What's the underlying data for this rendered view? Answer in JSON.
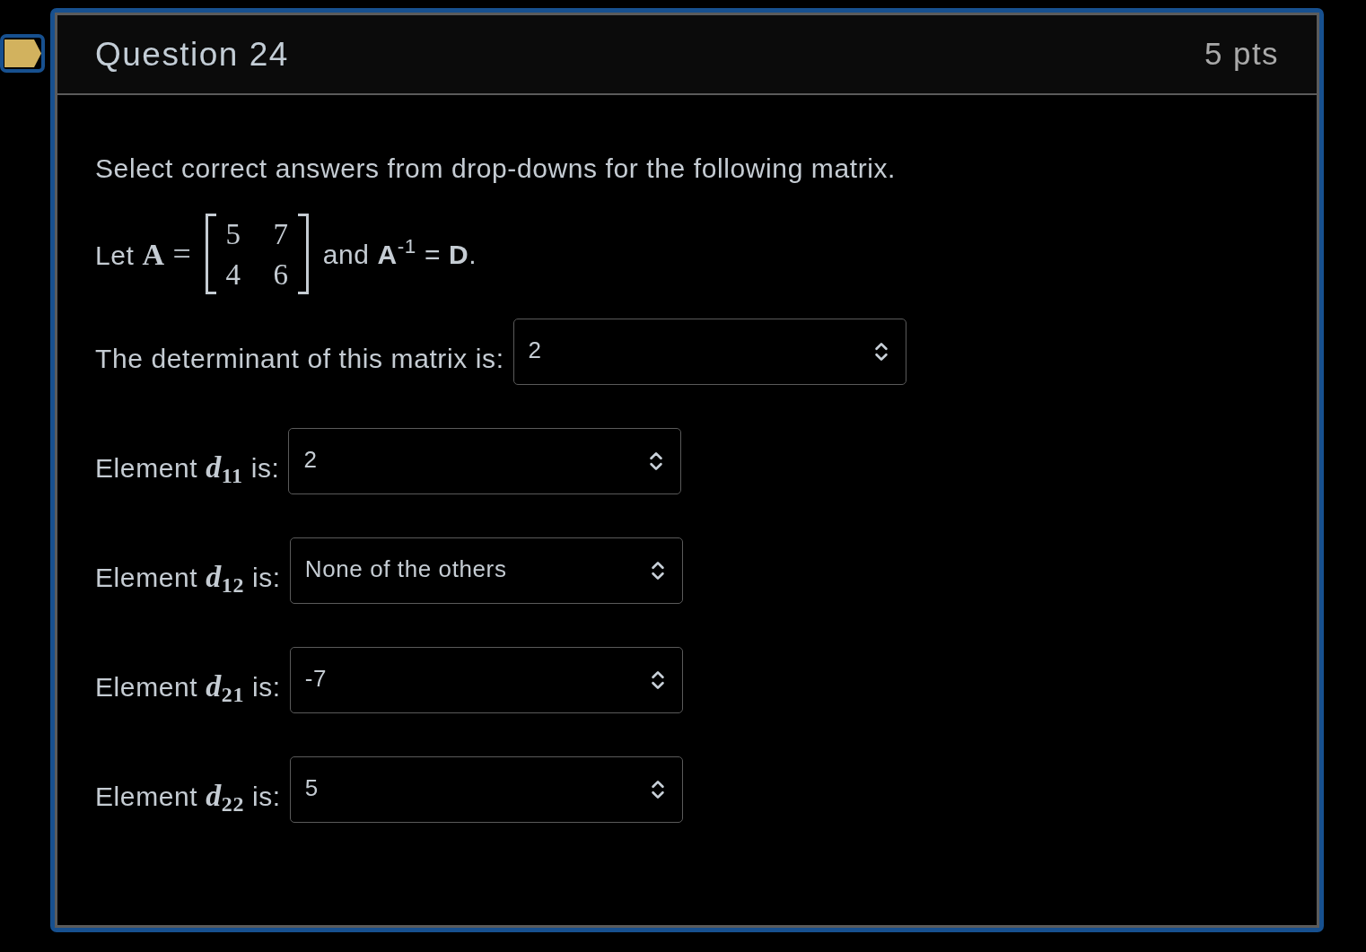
{
  "question": {
    "flagged": true,
    "title": "Question 24",
    "points": "5 pts"
  },
  "instructions": "Select correct answers from drop-downs for the following matrix.",
  "statement": {
    "lead": "Let",
    "symbol": "A",
    "relation": "=",
    "matrix": [
      [
        "5",
        "7"
      ],
      [
        "4",
        "6"
      ]
    ],
    "tail": "and **A**$^{-1}$ = **D**."
  },
  "answers": [
    {
      "kind": "text",
      "label": "The determinant of this matrix is:",
      "value": "2"
    },
    {
      "kind": "element",
      "prefix": "Element",
      "variable": "d",
      "index": "11",
      "suffix": "is:",
      "value": "2"
    },
    {
      "kind": "element",
      "prefix": "Element",
      "variable": "d",
      "index": "12",
      "suffix": "is:",
      "value": "None of the others"
    },
    {
      "kind": "element",
      "prefix": "Element",
      "variable": "d",
      "index": "21",
      "suffix": "is:",
      "value": "-7"
    },
    {
      "kind": "element",
      "prefix": "Element",
      "variable": "d",
      "index": "22",
      "suffix": "is:",
      "value": "5"
    }
  ]
}
